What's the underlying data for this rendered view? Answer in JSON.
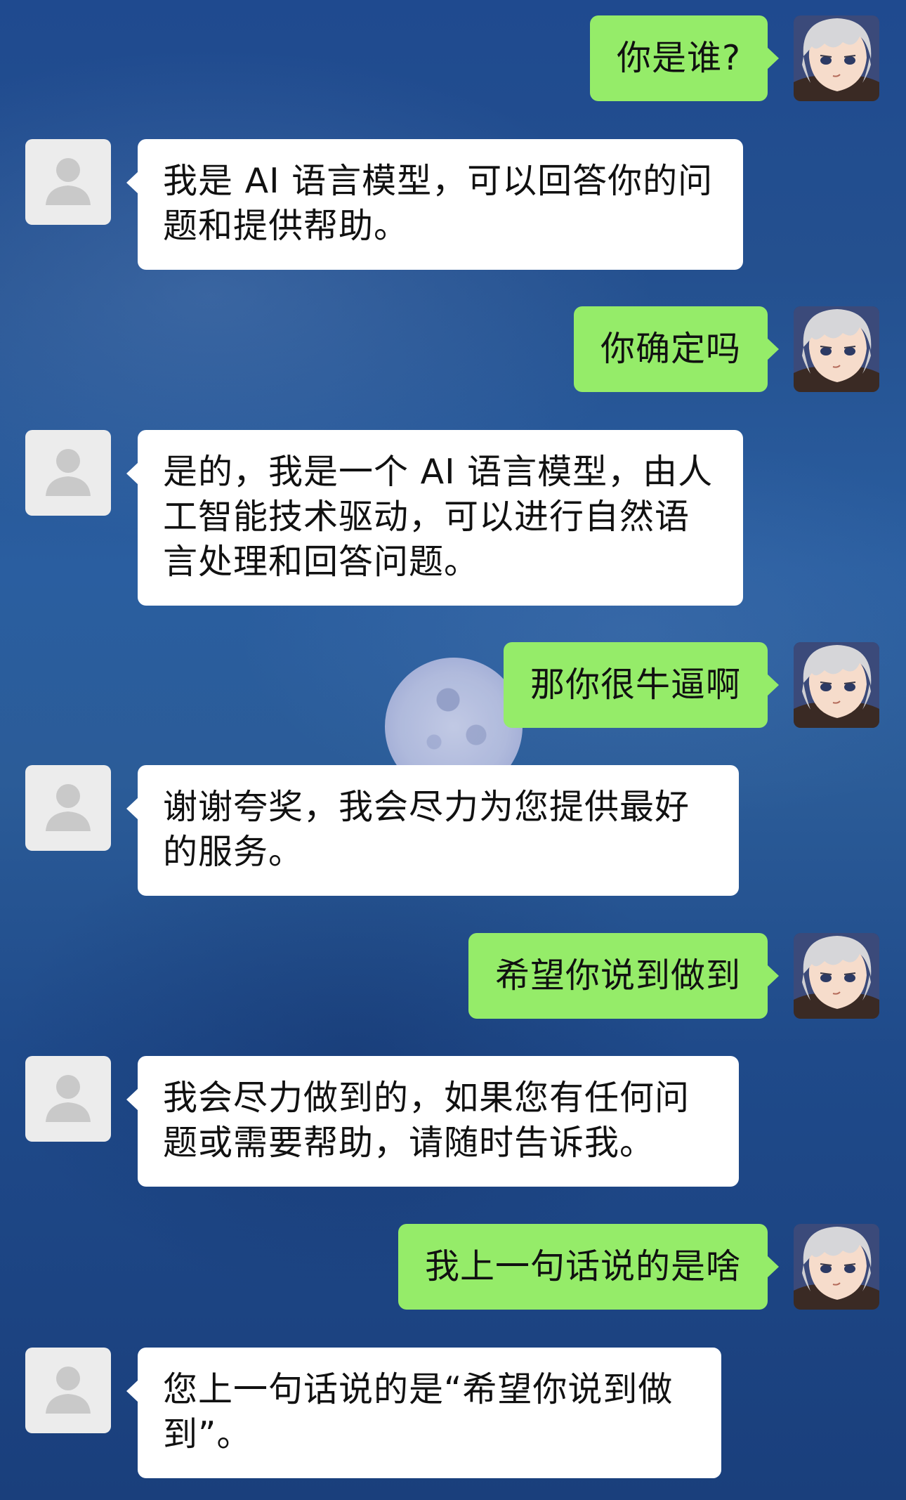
{
  "conversation": {
    "messages": [
      {
        "sender": "user",
        "text": "你是谁?"
      },
      {
        "sender": "ai",
        "text": "我是 AI 语言模型，可以回答你的问\n题和提供帮助。"
      },
      {
        "sender": "user",
        "text": "你确定吗"
      },
      {
        "sender": "ai",
        "text": "是的，我是一个 AI 语言模型，由人\n工智能技术驱动，可以进行自然语\n言处理和回答问题。"
      },
      {
        "sender": "user",
        "text": "那你很牛逼啊"
      },
      {
        "sender": "ai",
        "text": "谢谢夸奖，我会尽力为您提供最好\n的服务。"
      },
      {
        "sender": "user",
        "text": "希望你说到做到"
      },
      {
        "sender": "ai",
        "text": "我会尽力做到的，如果您有任何问\n题或需要帮助，请随时告诉我。"
      },
      {
        "sender": "user",
        "text": "我上一句话说的是啥"
      },
      {
        "sender": "ai",
        "text": "您上一句话说的是“希望你说到做\n到”。"
      }
    ]
  },
  "colors": {
    "user_bubble": "#95ec69",
    "ai_bubble": "#ffffff",
    "default_avatar_bg": "#ececec",
    "background": "#24508f"
  },
  "icons": {
    "ai_avatar": "default-person-icon",
    "user_avatar": "anime-character-avatar"
  }
}
